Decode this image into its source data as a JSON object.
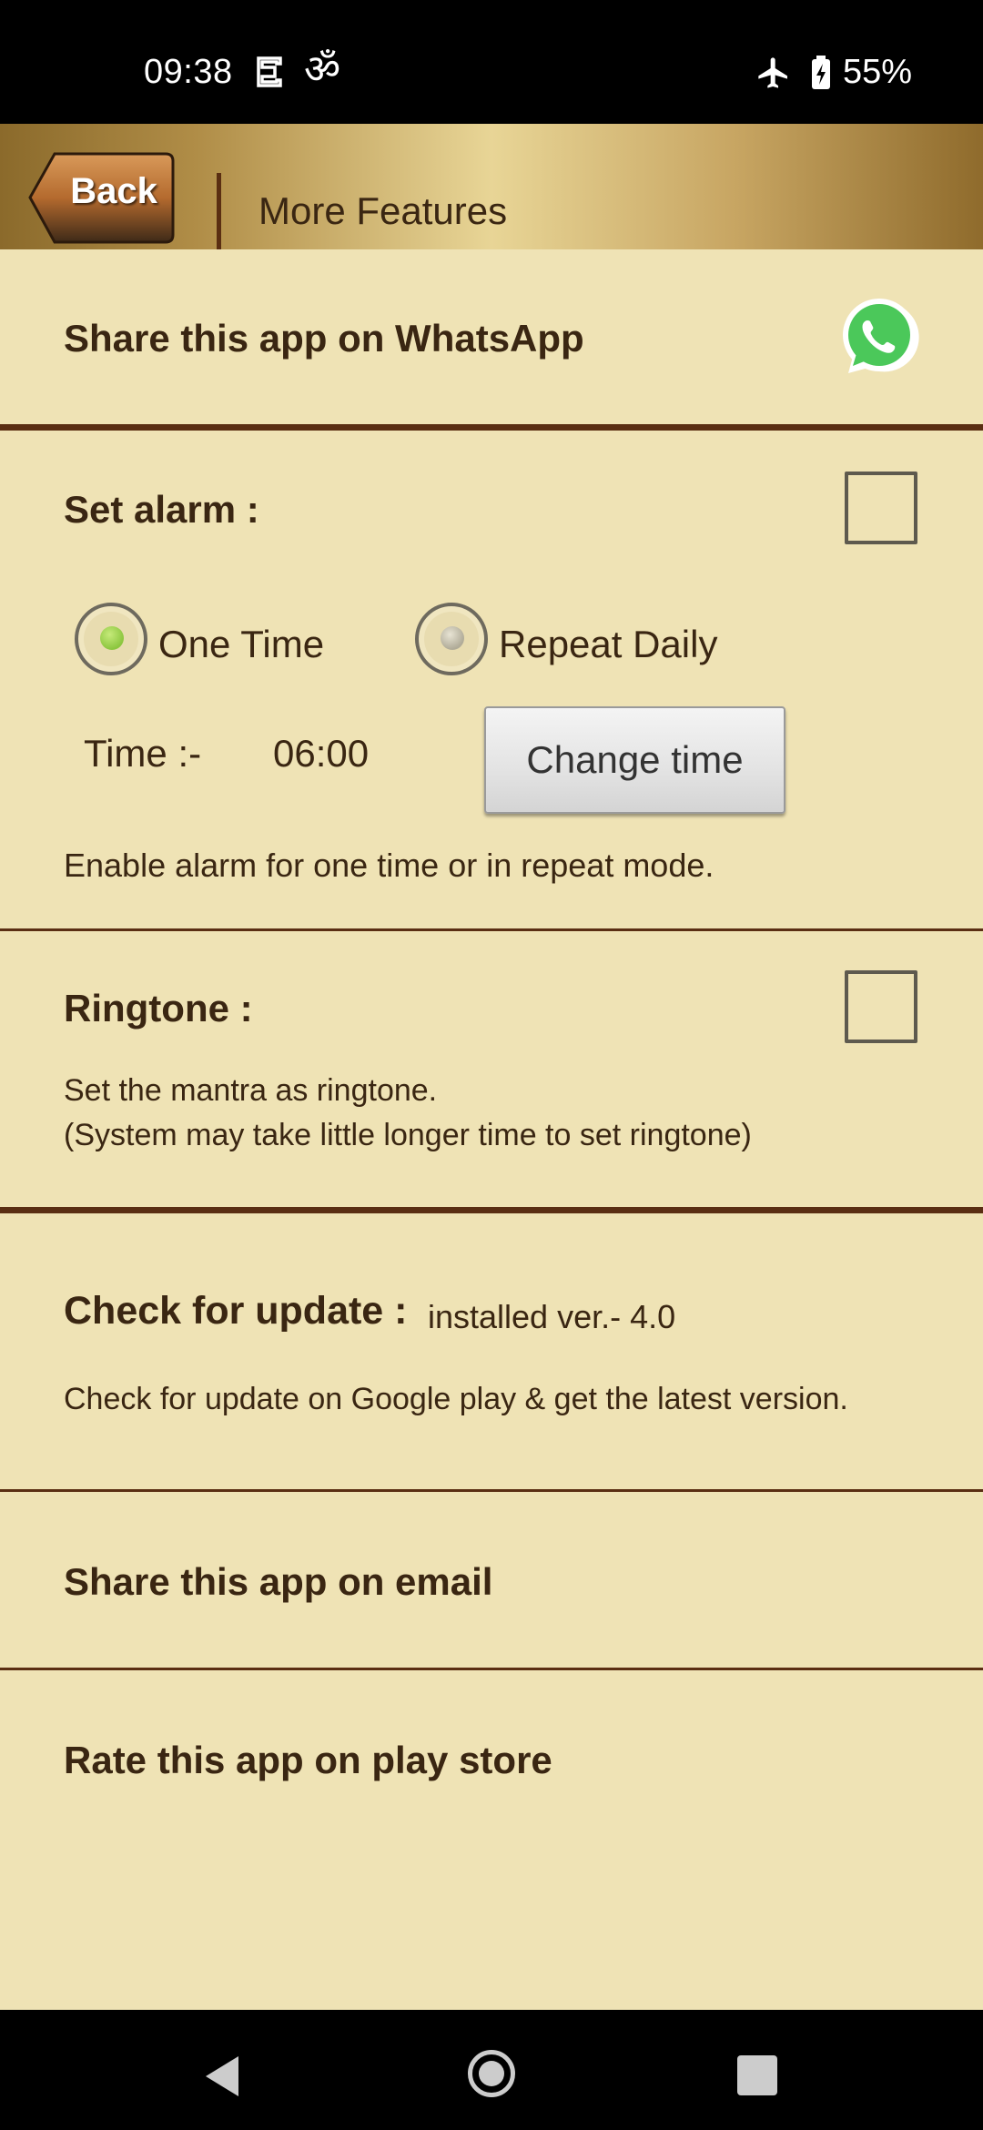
{
  "status_bar": {
    "time": "09:38",
    "icons": [
      "cast-icon",
      "om-icon",
      "airplane-icon",
      "battery-charging-icon"
    ],
    "battery_percent": "55%"
  },
  "header": {
    "back_label": "Back",
    "title": "More Features"
  },
  "whatsapp": {
    "title": "Share this app on WhatsApp",
    "icon": "whatsapp-icon"
  },
  "alarm": {
    "title": "Set alarm :",
    "checked": false,
    "options": [
      {
        "label": "One Time",
        "selected": true
      },
      {
        "label": "Repeat Daily",
        "selected": false
      }
    ],
    "time_label": "Time :-",
    "time_value": "06:00",
    "change_button": "Change time",
    "description": "Enable alarm for one time or in repeat mode."
  },
  "ringtone": {
    "title": "Ringtone :",
    "checked": false,
    "description_line1": "Set the mantra as ringtone.",
    "description_line2": "(System may take little longer time to set ringtone)"
  },
  "update": {
    "title": "Check for update :",
    "version": "installed ver.- 4.0",
    "description": "Check for update on Google play & get the latest version."
  },
  "email": {
    "title": "Share this app on email"
  },
  "rate": {
    "title": "Rate this app on play store"
  },
  "colors": {
    "background": "#efe3b5",
    "divider": "#5a2e12",
    "text": "#3a2612",
    "radio_selected": "#8cc63f",
    "whatsapp_green": "#4bc85a"
  }
}
